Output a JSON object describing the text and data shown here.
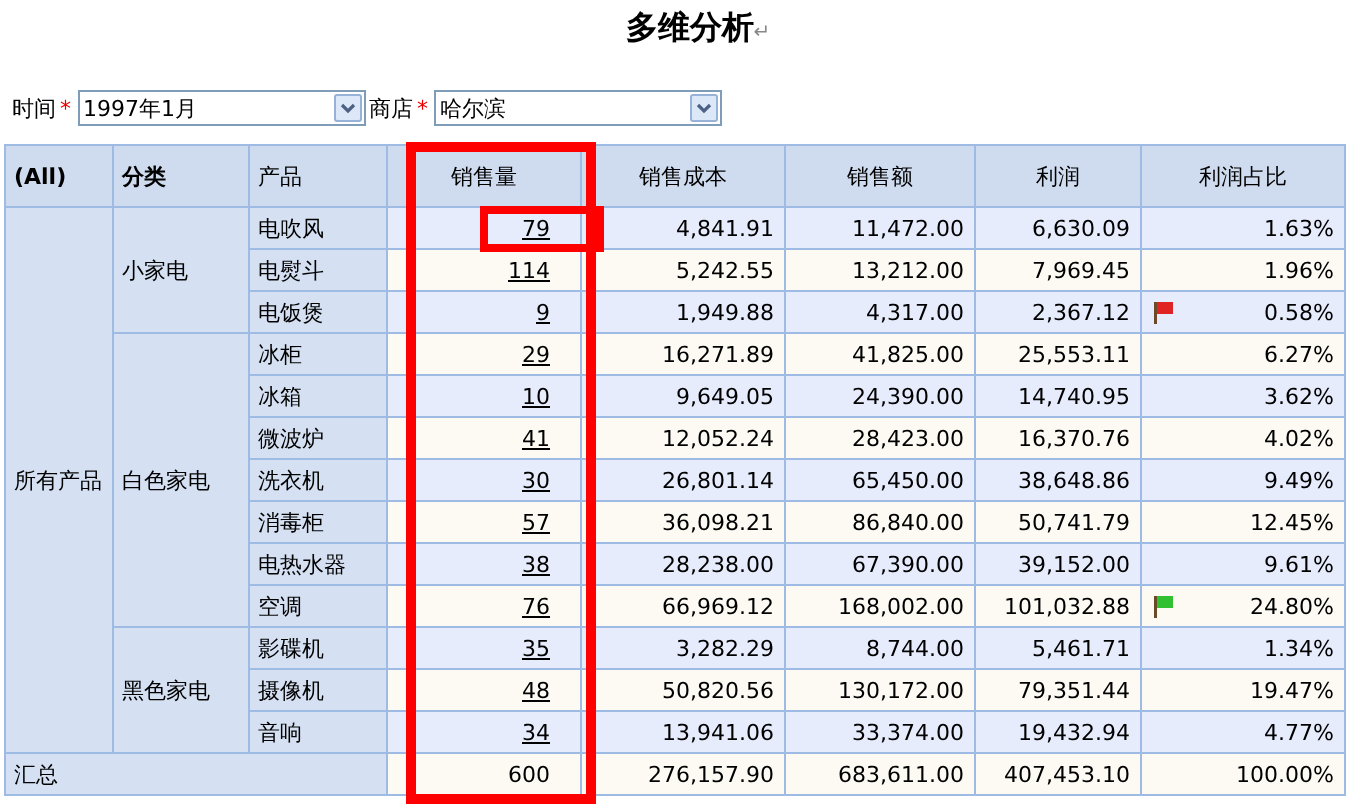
{
  "title": "多维分析",
  "paragraph_mark": "↵",
  "filters": [
    {
      "label": "时间",
      "required_mark": "*",
      "value": "1997年1月"
    },
    {
      "label": "商店",
      "required_mark": "*",
      "value": "哈尔滨"
    }
  ],
  "table": {
    "columns": [
      "(All)",
      "分类",
      "产品",
      "销售量",
      "销售成本",
      "销售额",
      "利润",
      "利润占比"
    ],
    "root": "所有产品",
    "groups": [
      {
        "name": "小家电",
        "rows": [
          {
            "product": "电吹风",
            "framed": true,
            "qty": "79",
            "cost": "4,841.91",
            "sales": "11,472.00",
            "profit": "6,630.09",
            "share": "1.63%"
          },
          {
            "product": "电熨斗",
            "qty": "114",
            "cost": "5,242.55",
            "sales": "13,212.00",
            "profit": "7,969.45",
            "share": "1.96%"
          },
          {
            "product": "电饭煲",
            "qty": "9",
            "cost": "1,949.88",
            "sales": "4,317.00",
            "profit": "2,367.12",
            "share": "0.58%",
            "flag": {
              "color": "#e02424"
            }
          }
        ]
      },
      {
        "name": "白色家电",
        "rows": [
          {
            "product": "冰柜",
            "qty": "29",
            "cost": "16,271.89",
            "sales": "41,825.00",
            "profit": "25,553.11",
            "share": "6.27%"
          },
          {
            "product": "冰箱",
            "qty": "10",
            "cost": "9,649.05",
            "sales": "24,390.00",
            "profit": "14,740.95",
            "share": "3.62%"
          },
          {
            "product": "微波炉",
            "qty": "41",
            "cost": "12,052.24",
            "sales": "28,423.00",
            "profit": "16,370.76",
            "share": "4.02%"
          },
          {
            "product": "洗衣机",
            "qty": "30",
            "cost": "26,801.14",
            "sales": "65,450.00",
            "profit": "38,648.86",
            "share": "9.49%"
          },
          {
            "product": "消毒柜",
            "qty": "57",
            "cost": "36,098.21",
            "sales": "86,840.00",
            "profit": "50,741.79",
            "share": "12.45%"
          },
          {
            "product": "电热水器",
            "qty": "38",
            "cost": "28,238.00",
            "sales": "67,390.00",
            "profit": "39,152.00",
            "share": "9.61%"
          },
          {
            "product": "空调",
            "qty": "76",
            "cost": "66,969.12",
            "sales": "168,002.00",
            "profit": "101,032.88",
            "share": "24.80%",
            "flag": {
              "color": "#30c030"
            }
          }
        ]
      },
      {
        "name": "黑色家电",
        "rows": [
          {
            "product": "影碟机",
            "qty": "35",
            "cost": "3,282.29",
            "sales": "8,744.00",
            "profit": "5,461.71",
            "share": "1.34%"
          },
          {
            "product": "摄像机",
            "qty": "48",
            "cost": "50,820.56",
            "sales": "130,172.00",
            "profit": "79,351.44",
            "share": "19.47%"
          },
          {
            "product": "音响",
            "qty": "34",
            "cost": "13,941.06",
            "sales": "33,374.00",
            "profit": "19,432.94",
            "share": "4.77%"
          }
        ]
      }
    ],
    "quantity_column_framed": true,
    "total": {
      "label": "汇总",
      "qty": "600",
      "cost": "276,157.90",
      "sales": "683,611.00",
      "profit": "407,453.10",
      "share": "100.00%"
    }
  }
}
